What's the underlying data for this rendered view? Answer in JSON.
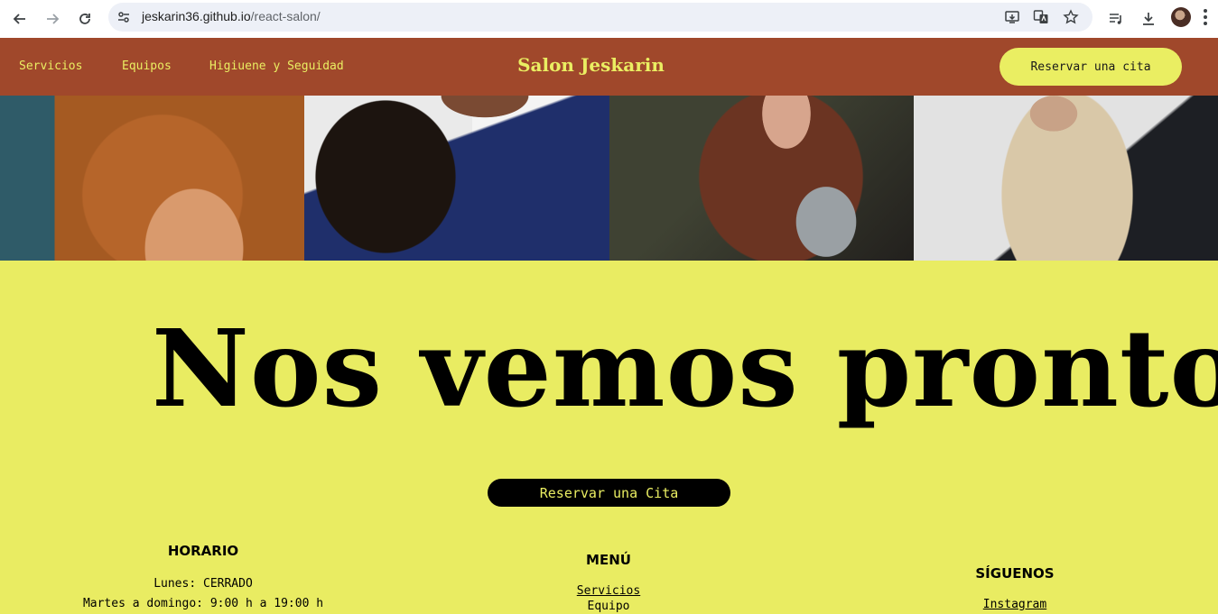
{
  "browser": {
    "url_host": "jeskarin36.github.io",
    "url_path": "/react-salon/"
  },
  "header": {
    "nav": [
      "Servicios",
      "Equipos",
      "Higiuene y Seguidad"
    ],
    "brand": "Salon Jeskarin",
    "cta": "Reservar una cita",
    "bg_color": "#a0482b",
    "accent_color": "#eaee62"
  },
  "hero": {
    "title": "Nos vemos pronto",
    "cta": "Reservar una Cita",
    "bg_color": "#e9ec62"
  },
  "footer": {
    "horario": {
      "heading": "HORARIO",
      "lines": [
        "Lunes: CERRADO",
        "Martes a domingo: 9:00 h a 19:00 h"
      ]
    },
    "menu": {
      "heading": "MENÚ",
      "links": [
        "Servicios",
        "Equipo"
      ]
    },
    "siguenos": {
      "heading": "SÍGUENOS",
      "links": [
        "Instagram"
      ]
    }
  }
}
